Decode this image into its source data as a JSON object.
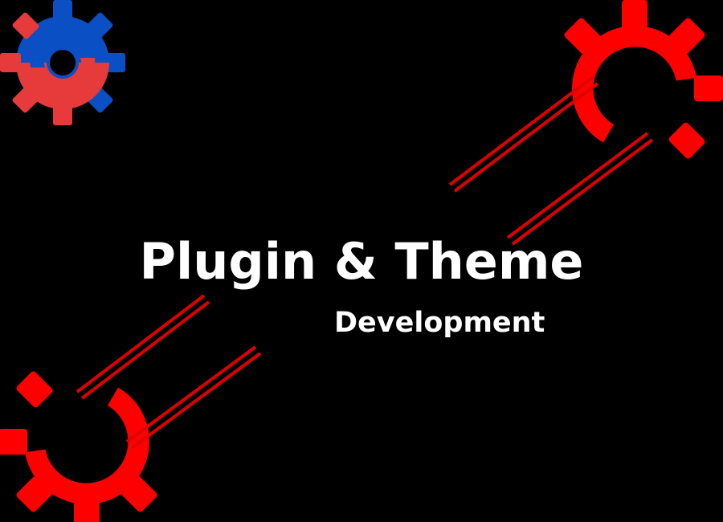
{
  "headline": {
    "title": "Plugin & Theme",
    "subtitle": "Development"
  },
  "graphics": {
    "logo": "gear-swirl-logo",
    "top_right_gear": "gear-outline-icon",
    "bottom_left_gear": "gear-outline-icon"
  },
  "colors": {
    "background": "#000000",
    "text": "#ffffff",
    "gear_red": "#ff0000",
    "logo_blue": "#0b4fc4",
    "logo_red": "#e73a3a",
    "stripe_red": "#e00000"
  }
}
